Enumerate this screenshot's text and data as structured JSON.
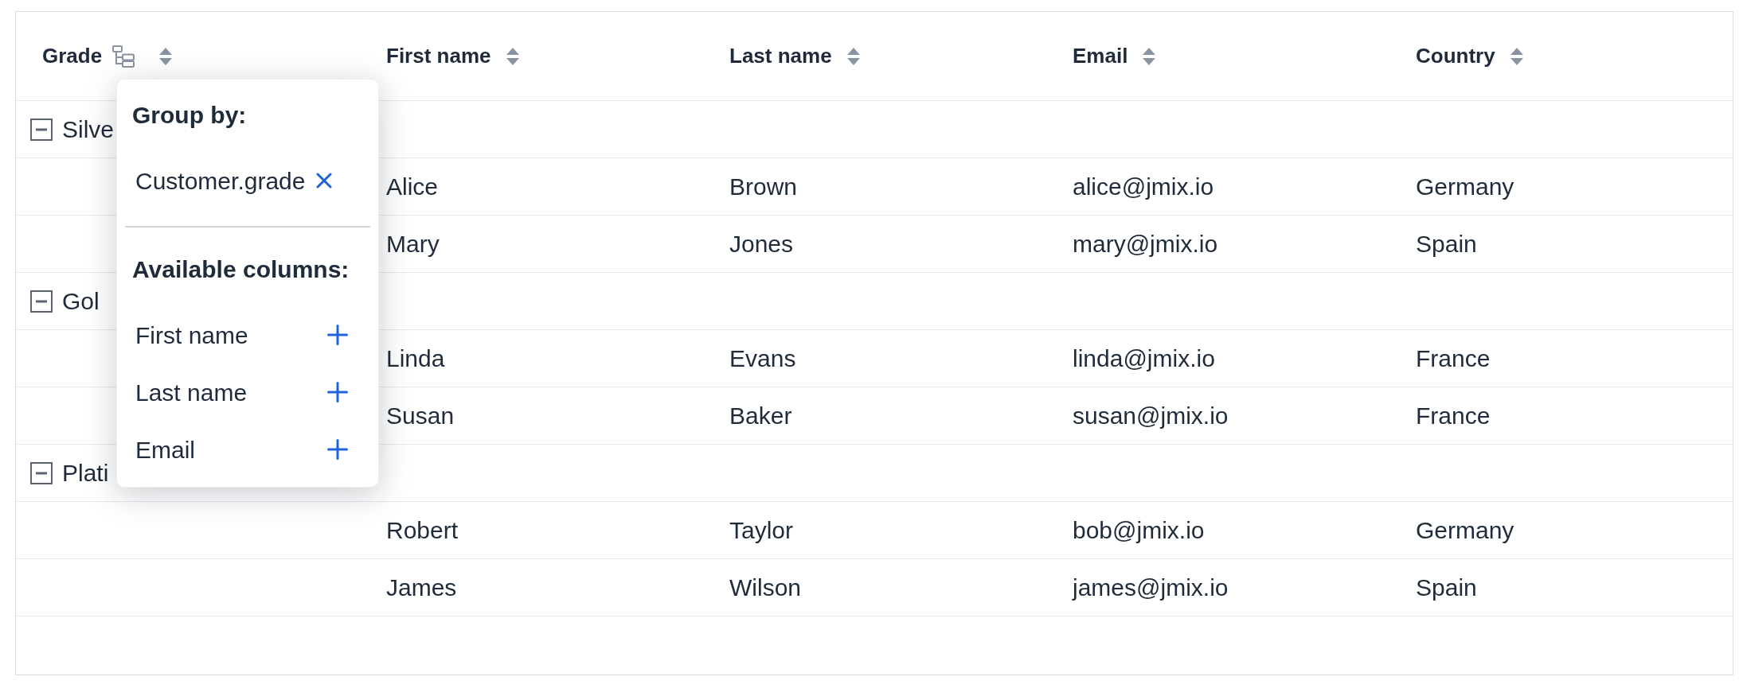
{
  "table": {
    "columns": [
      {
        "label": "Grade",
        "kind": "grouped"
      },
      {
        "label": "First name",
        "kind": "plain"
      },
      {
        "label": "Last name",
        "kind": "plain"
      },
      {
        "label": "Email",
        "kind": "plain"
      },
      {
        "label": "Country",
        "kind": "plain"
      }
    ],
    "rows": [
      {
        "kind": "group",
        "label": "Silve",
        "expanded": true
      },
      {
        "kind": "item",
        "cells": [
          "Alice",
          "Brown",
          "alice@jmix.io",
          "Germany"
        ]
      },
      {
        "kind": "item",
        "cells": [
          "Mary",
          "Jones",
          "mary@jmix.io",
          "Spain"
        ]
      },
      {
        "kind": "group",
        "label": "Gol",
        "expanded": true
      },
      {
        "kind": "item",
        "cells": [
          "Linda",
          "Evans",
          "linda@jmix.io",
          "France"
        ]
      },
      {
        "kind": "item",
        "cells": [
          "Susan",
          "Baker",
          "susan@jmix.io",
          "France"
        ]
      },
      {
        "kind": "group",
        "label": "Plati",
        "expanded": true
      },
      {
        "kind": "item",
        "cells": [
          "Robert",
          "Taylor",
          "bob@jmix.io",
          "Germany"
        ]
      },
      {
        "kind": "item",
        "cells": [
          "James",
          "Wilson",
          "james@jmix.io",
          "Spain"
        ]
      }
    ]
  },
  "group_by_popup": {
    "title": "Group by:",
    "grouped": [
      "Customer.grade"
    ],
    "available_title": "Available columns:",
    "available": [
      "First name",
      "Last name",
      "Email"
    ]
  }
}
